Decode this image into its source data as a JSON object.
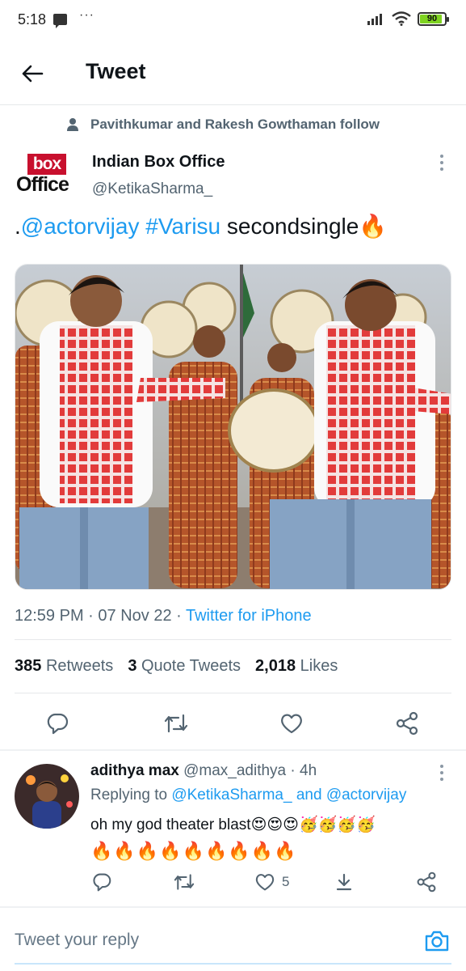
{
  "status_bar": {
    "time": "5:18",
    "dots": "···",
    "battery_percent": "90",
    "battery_level": 0.9
  },
  "header": {
    "title": "Tweet"
  },
  "social_context": {
    "text": "Pavithkumar and Rakesh Gowthaman follow"
  },
  "tweet": {
    "author_logo_top": "box",
    "author_logo_bottom": "Office",
    "author_name": "Indian Box Office",
    "author_handle": "@KetikaSharma_",
    "text_prefix": ".",
    "mention": "@actorvijay",
    "hashtag": "#Varisu",
    "text_rest": " secondsingle",
    "text_emoji": "🔥",
    "time": "12:59 PM",
    "date": "07 Nov 22",
    "separator": " · ",
    "source": "Twitter for iPhone",
    "retweets_count": "385",
    "retweets_label": "Retweets",
    "quotes_count": "3",
    "quotes_label": "Quote Tweets",
    "likes_count": "2,018",
    "likes_label": "Likes"
  },
  "reply": {
    "name": "adithya max",
    "handle": "@max_adithya",
    "dot": " · ",
    "age": "4h",
    "replying_label": "Replying to ",
    "replying_to_1": "@KetikaSharma_",
    "replying_and": " and ",
    "replying_to_2": "@actorvijay",
    "text": "oh my god theater blast😍😍😍🥳🥳🥳🥳",
    "emoji_line": "🔥🔥🔥🔥🔥🔥🔥🔥🔥",
    "like_count": "5"
  },
  "compose": {
    "placeholder": "Tweet your reply"
  },
  "colors": {
    "accent": "#1d9bf0",
    "muted": "#536471",
    "logo_red": "#c8102e"
  },
  "icons": [
    "message-icon",
    "wifi-icon",
    "signal-icon",
    "battery-icon",
    "back-arrow-icon",
    "person-icon",
    "more-vertical-icon",
    "reply-icon",
    "retweet-icon",
    "like-icon",
    "share-icon",
    "camera-icon"
  ]
}
